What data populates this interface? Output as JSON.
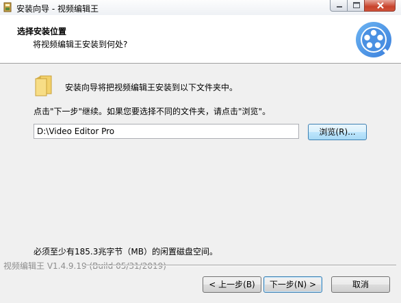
{
  "window": {
    "title": "安装向导 - 视频编辑王"
  },
  "header": {
    "title": "选择安装位置",
    "subtitle": "将视频编辑王安装到何处?"
  },
  "body": {
    "intro": "安装向导将把视频编辑王安装到以下文件夹中。",
    "instruction": "点击\"下一步\"继续。如果您要选择不同的文件夹，请点击\"浏览\"。",
    "path_value": "D:\\Video Editor Pro",
    "browse_label": "浏览(R)...",
    "space_required": "必须至少有185.3兆字节（MB）的闲置磁盘空间。"
  },
  "footer": {
    "version": "视频编辑王 V1.4.9.19  (Build 05/31/2019)",
    "back_label": "< 上一步(B)",
    "next_label": "下一步(N) >",
    "cancel_label": "取消"
  },
  "colors": {
    "logo_blue": "#4a90e2",
    "logo_light": "#8cc4f5",
    "folder_yellow": "#f2d16b"
  },
  "icons": {
    "app": "installer-app-icon",
    "logo": "video-reel-logo-icon",
    "folder": "folder-icon",
    "minimize": "minimize-icon",
    "maximize": "maximize-icon",
    "close": "close-icon"
  }
}
